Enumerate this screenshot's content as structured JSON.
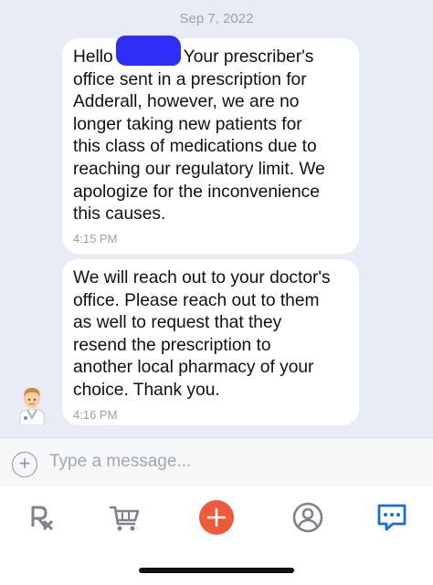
{
  "chat": {
    "date": "Sep 7, 2022",
    "messages": [
      {
        "text_before_redaction": "Hello",
        "text_after_redaction": " Your prescriber's\noffice sent in a prescription for\nAdderall, however, we are no\nlonger taking new patients for\nthis class of medications due to\nreaching our regulatory limit. We\napologize for the inconvenience\nthis causes.",
        "time": "4:15 PM"
      },
      {
        "text": "We will reach out to your doctor's\noffice. Please reach out to them\nas well to request that they\nresend the prescription to\nanother local pharmacy of your\nchoice. Thank you.",
        "time": "4:16 PM"
      }
    ],
    "sender_avatar": "pharmacist-avatar-icon"
  },
  "composer": {
    "add_button_label": "+",
    "placeholder": "Type a message..."
  },
  "tabbar": {
    "tabs": [
      {
        "icon": "rx-icon"
      },
      {
        "icon": "cart-icon"
      },
      {
        "icon": "add-icon"
      },
      {
        "icon": "account-icon"
      },
      {
        "icon": "chat-icon",
        "active": true
      }
    ]
  },
  "colors": {
    "accent_blue": "#1a6fd4",
    "add_orange": "#ef5a3a",
    "redaction": "#2f2cf5",
    "chat_background": "#e9ecf7"
  }
}
